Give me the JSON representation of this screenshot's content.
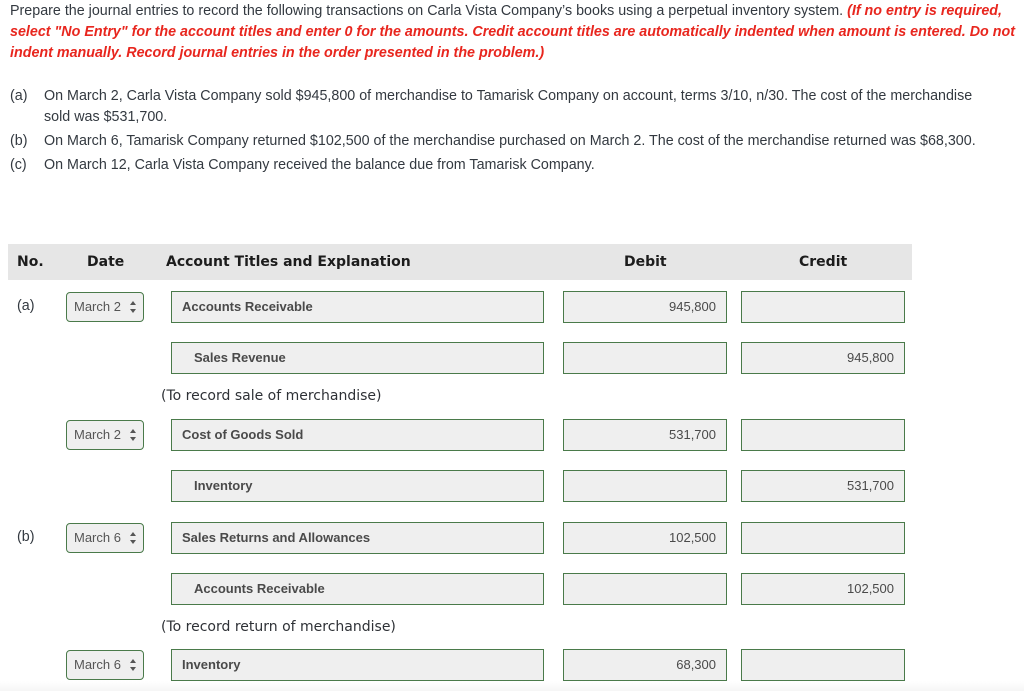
{
  "instructions": {
    "main": "Prepare the journal entries to record the following transactions on Carla Vista Company’s books using a perpetual inventory system.",
    "note": "(If no entry is required, select \"No Entry\" for the account titles and enter 0 for the amounts. Credit account titles are automatically indented when amount is entered. Do not indent manually. Record journal entries in the order presented in the problem.)"
  },
  "problems": [
    {
      "label": "(a)",
      "text": "On March 2, Carla Vista Company sold $945,800 of merchandise to Tamarisk Company on account, terms 3/10, n/30. The cost of the merchandise sold was $531,700."
    },
    {
      "label": "(b)",
      "text": "On March 6, Tamarisk Company returned $102,500 of the merchandise purchased on March 2. The cost of the merchandise returned was $68,300."
    },
    {
      "label": "(c)",
      "text": "On March 12, Carla Vista Company received the balance due from Tamarisk Company."
    }
  ],
  "table": {
    "headers": {
      "no": "No.",
      "date": "Date",
      "account": "Account Titles and Explanation",
      "debit": "Debit",
      "credit": "Credit"
    },
    "rows": [
      {
        "no": "(a)",
        "date": "March 2",
        "account": "Accounts Receivable",
        "debit": "945,800",
        "credit": ""
      },
      {
        "no": "",
        "date": "",
        "account": "Sales Revenue",
        "debit": "",
        "credit": "945,800"
      },
      {
        "no": "",
        "date": "March 2",
        "account": "Cost of Goods Sold",
        "debit": "531,700",
        "credit": ""
      },
      {
        "no": "",
        "date": "",
        "account": "Inventory",
        "debit": "",
        "credit": "531,700"
      },
      {
        "no": "(b)",
        "date": "March 6",
        "account": "Sales Returns and Allowances",
        "debit": "102,500",
        "credit": ""
      },
      {
        "no": "",
        "date": "",
        "account": "Accounts Receivable",
        "debit": "",
        "credit": "102,500"
      },
      {
        "no": "",
        "date": "March 6",
        "account": "Inventory",
        "debit": "68,300",
        "credit": ""
      }
    ],
    "explanations": [
      "(To record sale of merchandise)",
      "(To record return of merchandise)"
    ]
  },
  "colors": {
    "note_red": "#e8261e",
    "field_border_green": "#4a7a4a",
    "header_bg": "#e6e6e6",
    "field_bg": "#efefef"
  }
}
